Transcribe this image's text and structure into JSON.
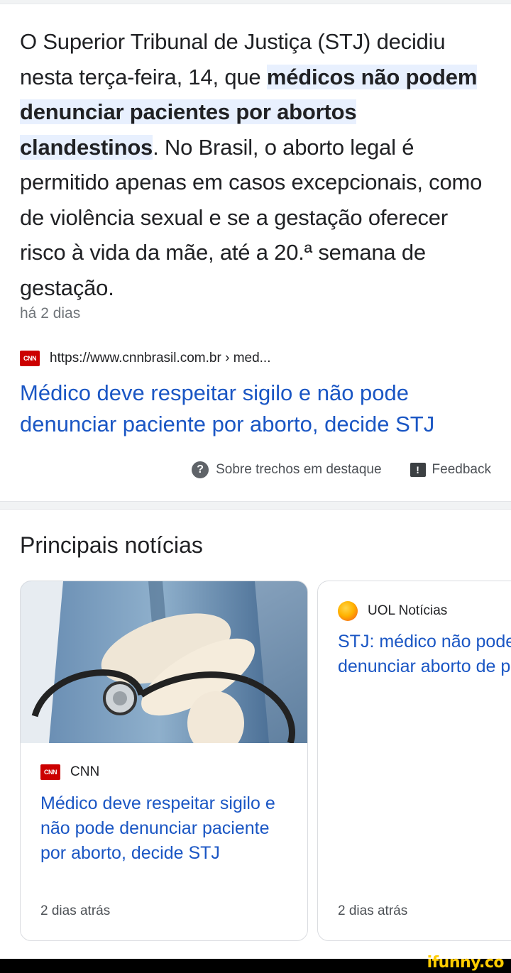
{
  "snippet": {
    "part1": "O Superior Tribunal de Justiça (STJ) decidiu nesta terça-feira, 14, que ",
    "highlight": "médicos não podem denunciar pacientes por abortos clandestinos",
    "part2": ". No Brasil, o aborto legal é permitido apenas em casos excepcionais, como de violência sexual e se a gestação oferecer risco à vida da mãe, até a 20.ª semana de gestação."
  },
  "date": "há 2 dias",
  "source": {
    "logo_text": "CNN",
    "url": "https://www.cnnbrasil.com.br › med..."
  },
  "result_title": "Médico deve respeitar sigilo e não pode denunciar paciente por aborto, decide STJ",
  "footer": {
    "about_label": "Sobre trechos em destaque",
    "feedback_label": "Feedback"
  },
  "top_stories": {
    "title": "Principais notícias",
    "cards": [
      {
        "source": "CNN",
        "title": "Médico deve respeitar sigilo e não pode denunciar paciente por aborto, decide STJ",
        "date": "2 dias atrás"
      },
      {
        "source": "UOL Notícias",
        "title": "STJ: médico não pode denunciar aborto de paciente",
        "date": "2 dias atrás"
      }
    ]
  },
  "watermark": "ifunny.co",
  "colors": {
    "link": "#1a56c4",
    "highlight_bg": "#e8f0fe",
    "cnn_red": "#cc0000"
  }
}
